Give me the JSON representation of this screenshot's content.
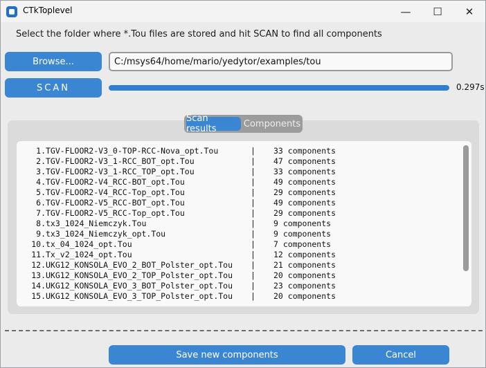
{
  "window": {
    "title": "CTkToplevel",
    "controls": {
      "minimize": "—",
      "maximize": "☐",
      "close": "✕"
    }
  },
  "instruction": "Select the folder where *.Tou files are stored and hit SCAN to find all components",
  "browse_label": "Browse...",
  "path_value": "C:/msys64/home/mario/yedytor/examples/tou",
  "scan_label": "SCAN",
  "progress": {
    "fraction": 1.0
  },
  "elapsed": "0.297s",
  "tabs": [
    {
      "label": "Scan results",
      "active": true
    },
    {
      "label": "Components",
      "active": false
    }
  ],
  "results": [
    {
      "num": "1.",
      "file": "TGV-FLOOR2-V3_0-TOP-RCC-Nova_opt.Tou",
      "sep": "|",
      "count": "33 components"
    },
    {
      "num": "2.",
      "file": "TGV-FLOOR2-V3_1-RCC_BOT_opt.Tou",
      "sep": "|",
      "count": "47 components"
    },
    {
      "num": "3.",
      "file": "TGV-FLOOR2-V3_1-RCC_TOP_opt.Tou",
      "sep": "|",
      "count": "33 components"
    },
    {
      "num": "4.",
      "file": "TGV-FLOOR2-V4_RCC-BOT_opt.Tou",
      "sep": "|",
      "count": "49 components"
    },
    {
      "num": "5.",
      "file": "TGV-FLOOR2-V4_RCC-Top_opt.Tou",
      "sep": "|",
      "count": "29 components"
    },
    {
      "num": "6.",
      "file": "TGV-FLOOR2-V5_RCC-BOT_opt.Tou",
      "sep": "|",
      "count": "49 components"
    },
    {
      "num": "7.",
      "file": "TGV-FLOOR2-V5_RCC-Top_opt.Tou",
      "sep": "|",
      "count": "29 components"
    },
    {
      "num": "8.",
      "file": "tx3_1024_Niemczyk.Tou",
      "sep": "|",
      "count": "9 components"
    },
    {
      "num": "9.",
      "file": "tx3_1024_Niemczyk_opt.Tou",
      "sep": "|",
      "count": "9 components"
    },
    {
      "num": "10.",
      "file": "tx_04_1024_opt.Tou",
      "sep": "|",
      "count": "7 components"
    },
    {
      "num": "11.",
      "file": "Tx_v2_1024_opt.Tou",
      "sep": "|",
      "count": "12 components"
    },
    {
      "num": "12.",
      "file": "UKG12_KONSOLA_EVO_2_BOT_Polster_opt.Tou",
      "sep": "|",
      "count": "21 components"
    },
    {
      "num": "13.",
      "file": "UKG12_KONSOLA_EVO_2_TOP_Polster_opt.Tou",
      "sep": "|",
      "count": "20 components"
    },
    {
      "num": "14.",
      "file": "UKG12_KONSOLA_EVO_3_BOT_Polster_opt.Tou",
      "sep": "|",
      "count": "23 components"
    },
    {
      "num": "15.",
      "file": "UKG12_KONSOLA_EVO_3_TOP_Polster_opt.Tou",
      "sep": "|",
      "count": "20 components"
    }
  ],
  "buttons": {
    "save": "Save new components",
    "cancel": "Cancel"
  },
  "colors": {
    "accent": "#3b86d2",
    "window_bg": "#ebebeb",
    "panel_bg": "#dbdbdb"
  }
}
